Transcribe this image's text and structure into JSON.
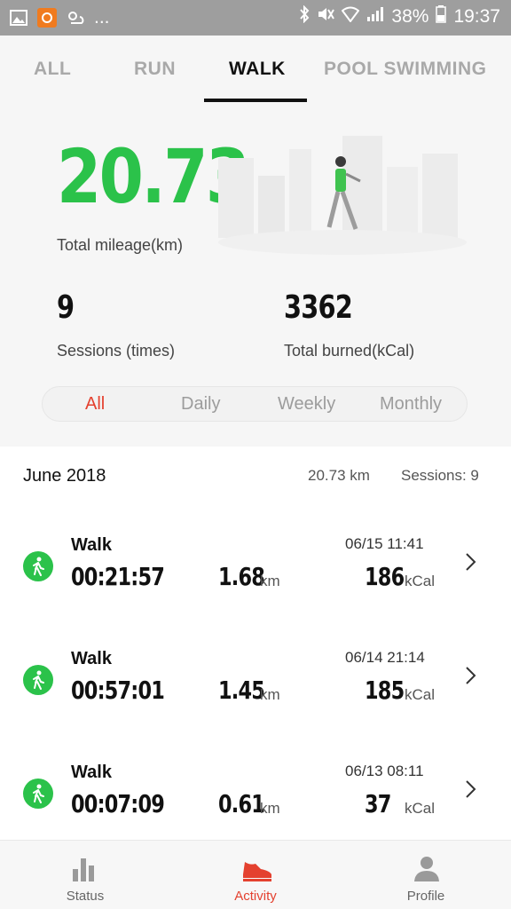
{
  "status_bar": {
    "battery": "38%",
    "time": "19:37",
    "more": "..."
  },
  "tabs": [
    {
      "label": "ALL"
    },
    {
      "label": "RUN"
    },
    {
      "label": "WALK"
    },
    {
      "label": "POOL SWIMMING"
    }
  ],
  "summary": {
    "total_mileage_value": "20.73",
    "total_mileage_label": "Total mileage(km)",
    "sessions_value": "9",
    "sessions_label": "Sessions (times)",
    "burned_value": "3362",
    "burned_label": "Total burned(kCal)"
  },
  "filters": [
    {
      "label": "All"
    },
    {
      "label": "Daily"
    },
    {
      "label": "Weekly"
    },
    {
      "label": "Monthly"
    }
  ],
  "month_group": {
    "title": "June 2018",
    "distance": "20.73 km",
    "sessions": "Sessions: 9"
  },
  "sessions": [
    {
      "type": "Walk",
      "datetime": "06/15  11:41",
      "duration": "00:21:57",
      "distance": "1.68",
      "distance_unit": "km",
      "calories": "186",
      "calories_unit": "kCal"
    },
    {
      "type": "Walk",
      "datetime": "06/14  21:14",
      "duration": "00:57:01",
      "distance": "1.45",
      "distance_unit": "km",
      "calories": "185",
      "calories_unit": "kCal"
    },
    {
      "type": "Walk",
      "datetime": "06/13  08:11",
      "duration": "00:07:09",
      "distance": "0.61",
      "distance_unit": "km",
      "calories": "37",
      "calories_unit": "kCal"
    }
  ],
  "bottom_nav": [
    {
      "label": "Status",
      "icon": "bar-chart-icon"
    },
    {
      "label": "Activity",
      "icon": "shoe-icon"
    },
    {
      "label": "Profile",
      "icon": "person-icon"
    }
  ],
  "colors": {
    "accent_green": "#2bc24a",
    "accent_red": "#e4412f"
  }
}
